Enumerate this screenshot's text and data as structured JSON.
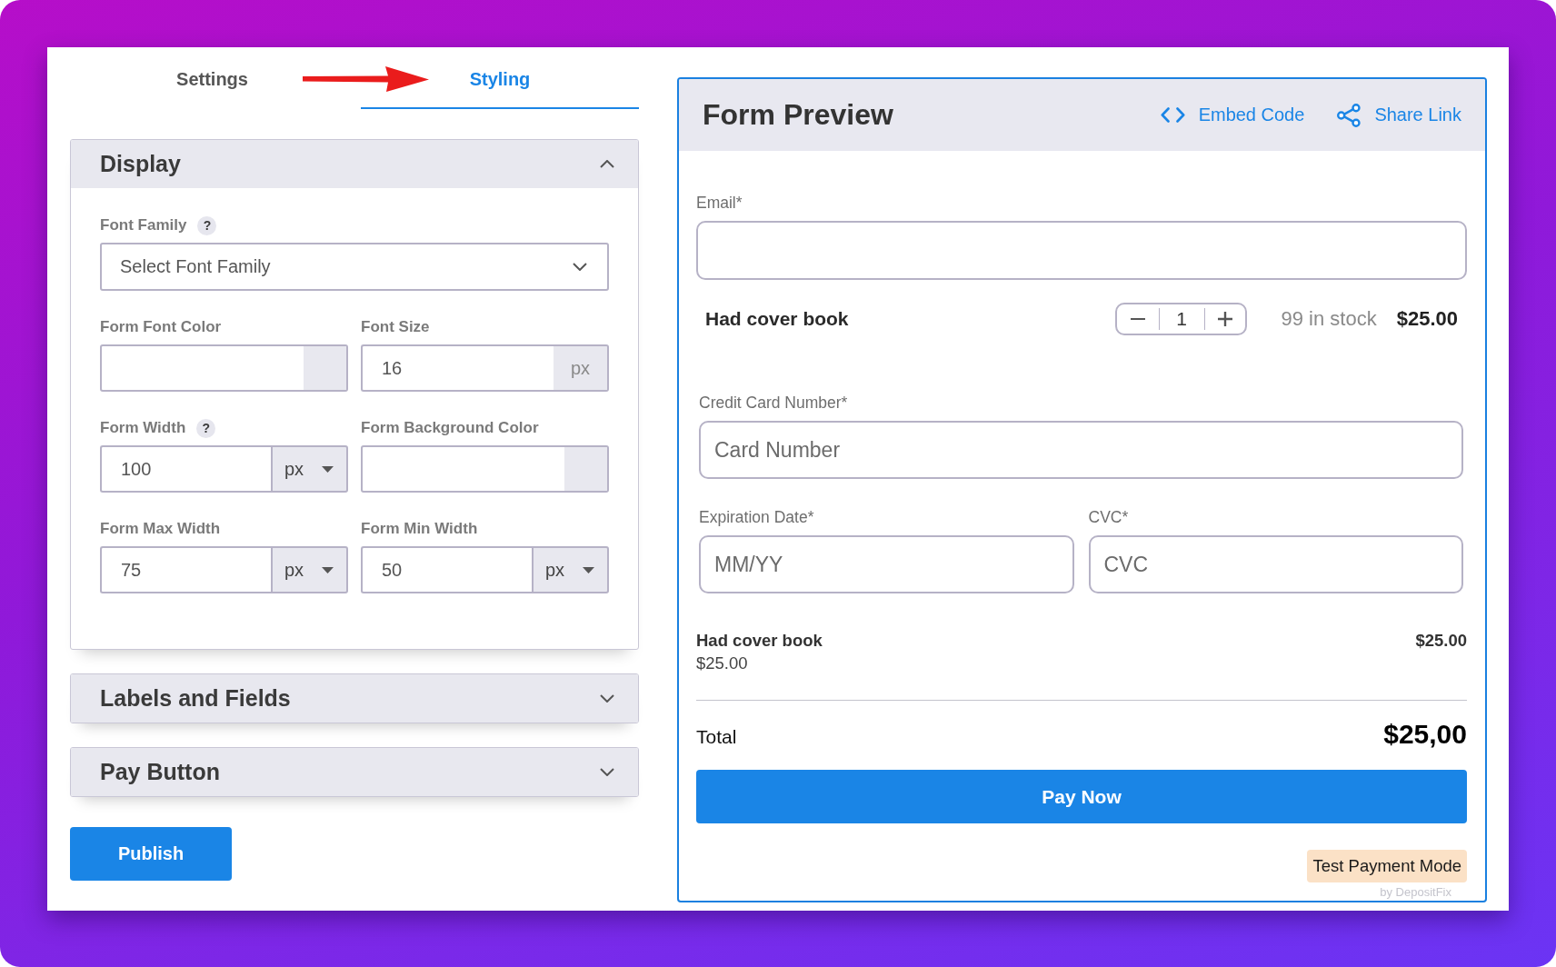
{
  "tabs": [
    {
      "label": "Settings",
      "selected": false
    },
    {
      "label": "Styling",
      "selected": true
    }
  ],
  "sections": [
    {
      "title": "Display",
      "expanded": true,
      "fields": [
        {
          "kind": "select",
          "label": "Font Family",
          "help": "?",
          "placeholder": "Select Font Family"
        },
        {
          "kind": "color",
          "label": "Form Font Color"
        },
        {
          "kind": "unit",
          "label": "Font Size",
          "value": "16",
          "unit": "px"
        },
        {
          "kind": "unit_select",
          "label": "Form Width",
          "help": "?",
          "value": "100",
          "unit": "px"
        },
        {
          "kind": "color",
          "label": "Form Background Color"
        },
        {
          "kind": "unit_select",
          "label": "Form Max Width",
          "value": "75",
          "unit": "px"
        },
        {
          "kind": "unit_select",
          "label": "Form Min Width",
          "value": "50",
          "unit": "px"
        }
      ]
    },
    {
      "title": "Labels and Fields",
      "expanded": false
    },
    {
      "title": "Pay Button",
      "expanded": false
    }
  ],
  "publish_button": "Publish",
  "preview": {
    "title": "Form Preview",
    "actions": [
      {
        "kind": "embed",
        "label": "Embed Code"
      },
      {
        "kind": "share",
        "label": "Share Link"
      }
    ],
    "email": {
      "label": "Email*"
    },
    "product": {
      "name": "Had cover book",
      "quantity": "1",
      "stock": "99 in stock",
      "price": "$25.00"
    },
    "card_number": {
      "label": "Credit Card Number*",
      "placeholder": "Card Number"
    },
    "card_details": [
      {
        "label": "Expiration Date*",
        "placeholder": "MM/YY"
      },
      {
        "label": "CVC*",
        "placeholder": "CVC"
      }
    ],
    "line_items": [
      {
        "name": "Had cover book",
        "unit_price": "$25.00",
        "amount": "$25.00"
      }
    ],
    "total": {
      "label": "Total",
      "amount": "$25,00"
    },
    "pay_button": "Pay Now",
    "mode_badge": "Test Payment Mode",
    "credit": "by DepositFix"
  }
}
